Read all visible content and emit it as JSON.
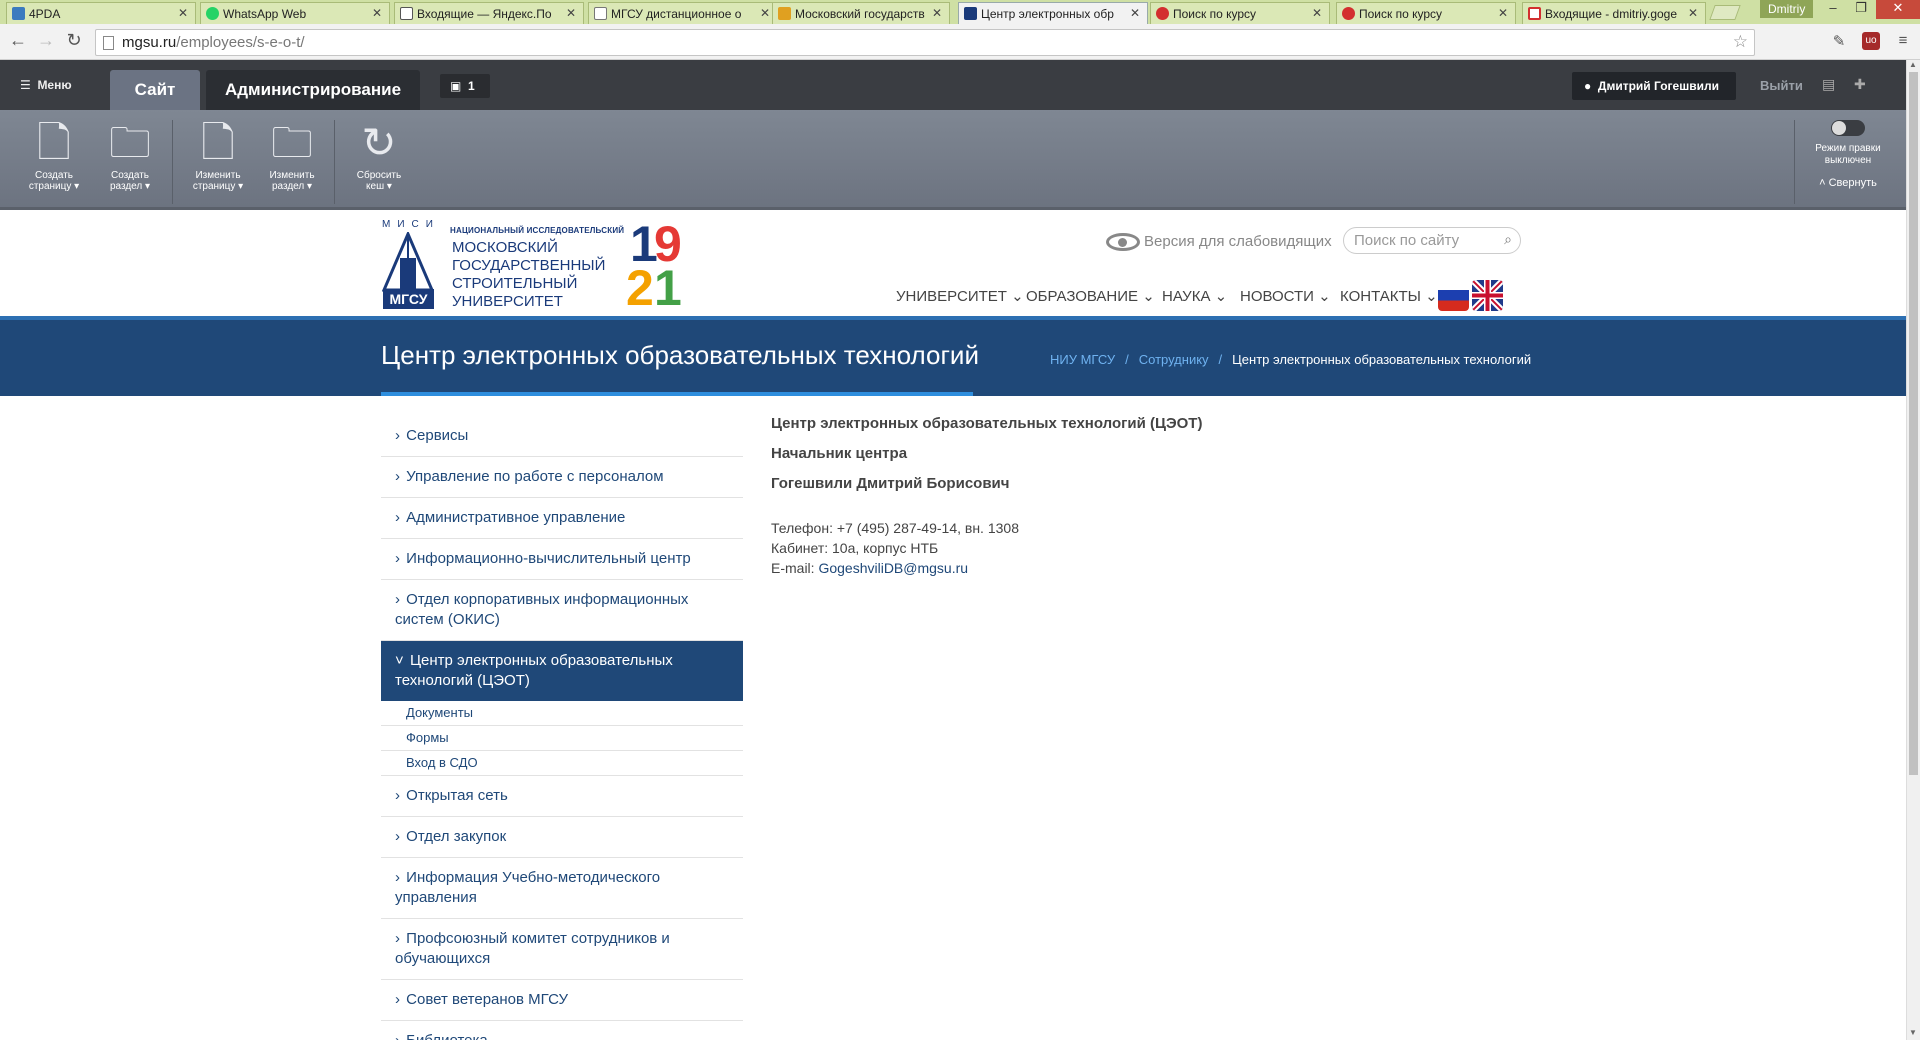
{
  "browser": {
    "tabs": [
      {
        "label": "4PDA",
        "color": "#3b7bbf"
      },
      {
        "label": "WhatsApp Web",
        "color": "#25d366"
      },
      {
        "label": "Входящие — Яндекс.По",
        "color": "#888888"
      },
      {
        "label": "МГСУ дистанционное о",
        "color": "#888888"
      },
      {
        "label": "Московский государств",
        "color": "#e0a020"
      },
      {
        "label": "Центр электронных обр",
        "color": "#1a3a7a"
      },
      {
        "label": "Поиск по курсу",
        "color": "#d32f2f"
      },
      {
        "label": "Поиск по курсу",
        "color": "#d32f2f"
      },
      {
        "label": "Входящие - dmitriy.goge",
        "color": "#d32f2f"
      }
    ],
    "user": "Dmitriy",
    "url_host": "mgsu.ru",
    "url_path": "/employees/s-e-o-t/"
  },
  "admin": {
    "menu_label": "Меню",
    "tab_site": "Сайт",
    "tab_admin": "Администрирование",
    "notifications": "1",
    "user_name": "Дмитрий Гогешвили",
    "logout": "Выйти",
    "tools": [
      {
        "line1": "Создать",
        "line2": "страницу",
        "icon": "new-page-icon"
      },
      {
        "line1": "Создать",
        "line2": "раздел",
        "icon": "new-folder-icon"
      },
      {
        "line1": "Изменить",
        "line2": "страницу",
        "icon": "edit-page-icon"
      },
      {
        "line1": "Изменить",
        "line2": "раздел",
        "icon": "edit-folder-icon"
      },
      {
        "line1": "Сбросить",
        "line2": "кеш",
        "icon": "refresh-icon"
      }
    ],
    "edit_mode_line1": "Режим правки",
    "edit_mode_line2": "выключен",
    "collapse": "Свернуть"
  },
  "site": {
    "logo_misi": "МИСИ",
    "logo_brand": "НАЦИОНАЛЬНЫЙ ИССЛЕДОВАТЕЛЬСКИЙ",
    "logo_lines": [
      "МОСКОВСКИЙ",
      "ГОСУДАРСТВЕННЫЙ",
      "СТРОИТЕЛЬНЫЙ",
      "УНИВЕРСИТЕТ"
    ],
    "logo_mgsu": "МГСУ",
    "year_digits": [
      "1",
      "9",
      "2",
      "1"
    ],
    "year_colors": [
      "#1a3a7a",
      "#e53935",
      "#f4a100",
      "#43a047"
    ],
    "blind_version": "Версия для слабовидящих",
    "search_placeholder": "Поиск по сайту",
    "nav": [
      "УНИВЕРСИТЕТ",
      "ОБРАЗОВАНИЕ",
      "НАУКА",
      "НОВОСТИ",
      "КОНТАКТЫ"
    ]
  },
  "page": {
    "title": "Центр электронных образовательных технологий",
    "breadcrumb": [
      "НИУ МГСУ",
      "Сотруднику",
      "Центр электронных образовательных технологий"
    ]
  },
  "sidebar": {
    "items_before": [
      "Сервисы",
      "Управление по работе с персоналом",
      "Административное управление",
      "Информационно-вычислительный центр",
      "Отдел корпоративных информационных систем (ОКИС)"
    ],
    "active": "Центр электронных образовательных технологий (ЦЭОТ)",
    "subitems": [
      "Документы",
      "Формы",
      "Вход в СДО"
    ],
    "items_after": [
      "Открытая сеть",
      "Отдел закупок",
      "Информация Учебно-методического управления",
      "Профсоюзный комитет сотрудников и обучающихся",
      "Совет ветеранов МГСУ",
      "Библиотека"
    ]
  },
  "content": {
    "heading": "Центр электронных образовательных технологий (ЦЭОТ)",
    "position": "Начальник центра",
    "person": "Гогешвили Дмитрий Борисович",
    "phone": "Телефон: +7 (495) 287-49-14, вн. 1308",
    "office": "Кабинет: 10а, корпус НТБ",
    "email_label": "E-mail: ",
    "email": "GogeshviliDB@mgsu.ru"
  }
}
